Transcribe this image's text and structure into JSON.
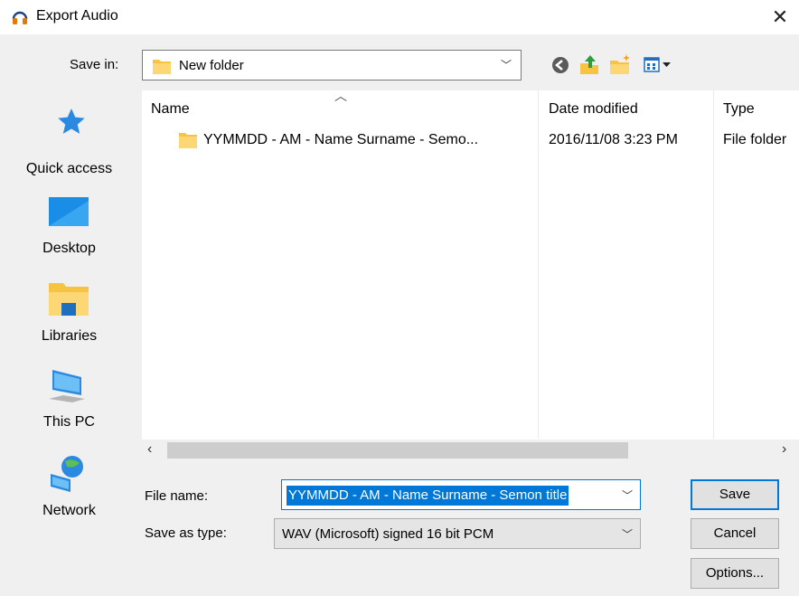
{
  "window": {
    "title": "Export Audio",
    "icon": "headphones-icon",
    "close_symbol": "✕"
  },
  "toolbar": {
    "save_in_label": "Save in:",
    "save_in_value": "New folder",
    "buttons": [
      "back-icon",
      "up-folder-icon",
      "new-folder-icon",
      "view-menu-icon"
    ]
  },
  "places": [
    {
      "label": "Quick access",
      "icon": "star-icon"
    },
    {
      "label": "Desktop",
      "icon": "desktop-icon"
    },
    {
      "label": "Libraries",
      "icon": "libraries-icon"
    },
    {
      "label": "This PC",
      "icon": "computer-icon"
    },
    {
      "label": "Network",
      "icon": "network-icon"
    }
  ],
  "file_list": {
    "columns": [
      "Name",
      "Date modified",
      "Type"
    ],
    "rows": [
      {
        "name": "YYMMDD - AM - Name Surname - Semo...",
        "date": "2016/11/08 3:23 PM",
        "type": "File folder"
      }
    ]
  },
  "form": {
    "file_name_label": "File name:",
    "file_name_value": "YYMMDD - AM - Name Surname - Semon title",
    "save_as_type_label": "Save as type:",
    "save_as_type_value": "WAV (Microsoft) signed 16 bit PCM"
  },
  "buttons": {
    "save": "Save",
    "cancel": "Cancel",
    "options": "Options..."
  },
  "colors": {
    "accent": "#0078d7",
    "folder": "#f6c342",
    "dialog_bg": "#f0f0f0"
  }
}
